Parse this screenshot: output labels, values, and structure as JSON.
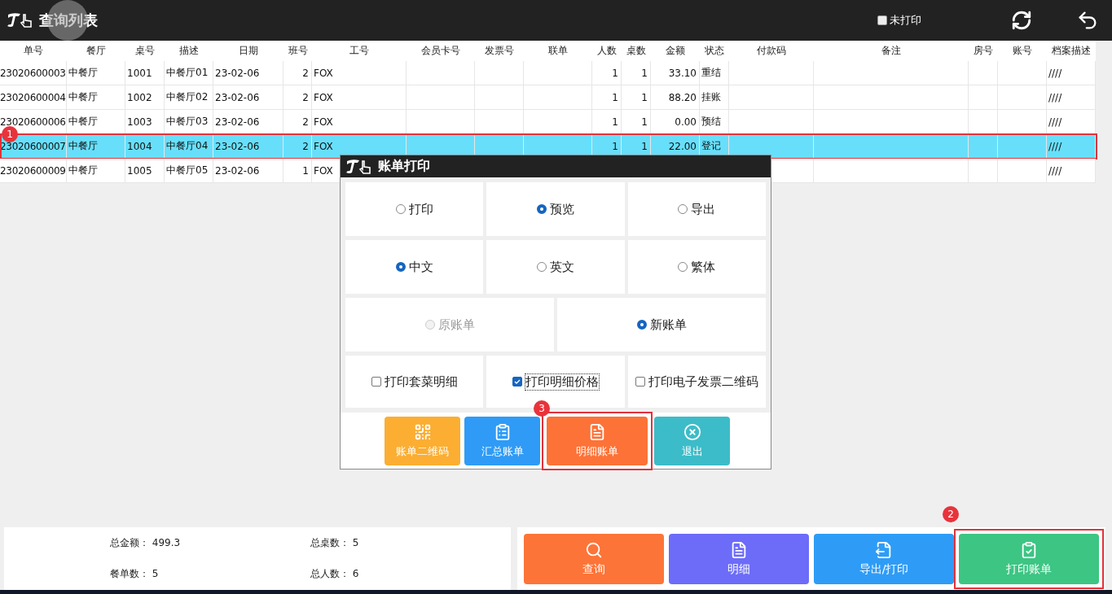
{
  "header": {
    "title": "查询列表",
    "unprinted_filter": {
      "label": "未打印",
      "checked": false
    }
  },
  "table": {
    "columns": [
      "单号",
      "餐厅",
      "桌号",
      "描述",
      "日期",
      "班号",
      "工号",
      "会员卡号",
      "发票号",
      "联单",
      "人数",
      "桌数",
      "金额",
      "状态",
      "付款码",
      "备注",
      "房号",
      "账号",
      "档案描述"
    ],
    "rows": [
      {
        "selected": false,
        "order_no": "23020600003",
        "restaurant": "中餐厅",
        "table_no": "1001",
        "description": "中餐厅01",
        "date": "23-02-06",
        "shift": "2",
        "staff_no": "FOX",
        "guests": "1",
        "tables": "1",
        "amount": "33.10",
        "status": "重结",
        "archive_desc": "////"
      },
      {
        "selected": false,
        "order_no": "23020600004",
        "restaurant": "中餐厅",
        "table_no": "1002",
        "description": "中餐厅02",
        "date": "23-02-06",
        "shift": "2",
        "staff_no": "FOX",
        "guests": "1",
        "tables": "1",
        "amount": "88.20",
        "status": "挂账",
        "archive_desc": "////"
      },
      {
        "selected": false,
        "order_no": "23020600006",
        "restaurant": "中餐厅",
        "table_no": "1003",
        "description": "中餐厅03",
        "date": "23-02-06",
        "shift": "2",
        "staff_no": "FOX",
        "guests": "1",
        "tables": "1",
        "amount": "0.00",
        "status": "预结",
        "archive_desc": "////"
      },
      {
        "selected": true,
        "highlighted": true,
        "badge": "1",
        "order_no": "23020600007",
        "restaurant": "中餐厅",
        "table_no": "1004",
        "description": "中餐厅04",
        "date": "23-02-06",
        "shift": "2",
        "staff_no": "FOX",
        "guests": "1",
        "tables": "1",
        "amount": "22.00",
        "status": "登记",
        "archive_desc": "////"
      },
      {
        "selected": false,
        "order_no": "23020600009",
        "restaurant": "中餐厅",
        "table_no": "1005",
        "description": "中餐厅05",
        "date": "23-02-06",
        "shift": "1",
        "staff_no": "FOX",
        "archive_desc": "////"
      }
    ]
  },
  "dialog": {
    "title": "账单打印",
    "option_rows": [
      {
        "kind": "radio",
        "options": [
          {
            "label": "打印",
            "selected": false,
            "disabled": false
          },
          {
            "label": "预览",
            "selected": true,
            "disabled": false
          },
          {
            "label": "导出",
            "selected": false,
            "disabled": false
          }
        ]
      },
      {
        "kind": "radio",
        "options": [
          {
            "label": "中文",
            "selected": true,
            "disabled": false
          },
          {
            "label": "英文",
            "selected": false,
            "disabled": false
          },
          {
            "label": "繁体",
            "selected": false,
            "disabled": false
          }
        ]
      },
      {
        "kind": "radio",
        "options": [
          {
            "label": "原账单",
            "selected": false,
            "disabled": true
          },
          {
            "label": "新账单",
            "selected": true,
            "disabled": false
          }
        ]
      },
      {
        "kind": "checkbox",
        "options": [
          {
            "label": "打印套菜明细",
            "checked": false,
            "focused": false
          },
          {
            "label": "打印明细价格",
            "checked": true,
            "focused": true
          },
          {
            "label": "打印电子发票二维码",
            "checked": false,
            "focused": false
          }
        ]
      }
    ],
    "buttons": [
      {
        "kind": "qrcode",
        "label": "账单二维码",
        "color": "#fbae32"
      },
      {
        "kind": "clipboard",
        "label": "汇总账单",
        "color": "#2f9bf6"
      },
      {
        "kind": "document",
        "label": "明细账单",
        "color": "#fd7237",
        "highlighted": true,
        "badge": "3"
      },
      {
        "kind": "exit",
        "label": "退出",
        "color": "#3cbcc8"
      }
    ]
  },
  "summary": [
    {
      "label": "总金额：",
      "value": "499.3"
    },
    {
      "label": "总桌数：",
      "value": "5"
    },
    {
      "label": "餐单数：",
      "value": "5"
    },
    {
      "label": "总人数：",
      "value": "6"
    }
  ],
  "actions": [
    {
      "kind": "search",
      "label": "查询",
      "color": "#fd7438",
      "highlighted": false
    },
    {
      "kind": "detail",
      "label": "明细",
      "color": "#6c6cf9",
      "highlighted": false
    },
    {
      "kind": "export",
      "label": "导出/打印",
      "color": "#2e9cf6",
      "highlighted": false
    },
    {
      "kind": "print_bill",
      "label": "打印账单",
      "color": "#3cc583",
      "highlighted": true,
      "badge": "2"
    }
  ]
}
